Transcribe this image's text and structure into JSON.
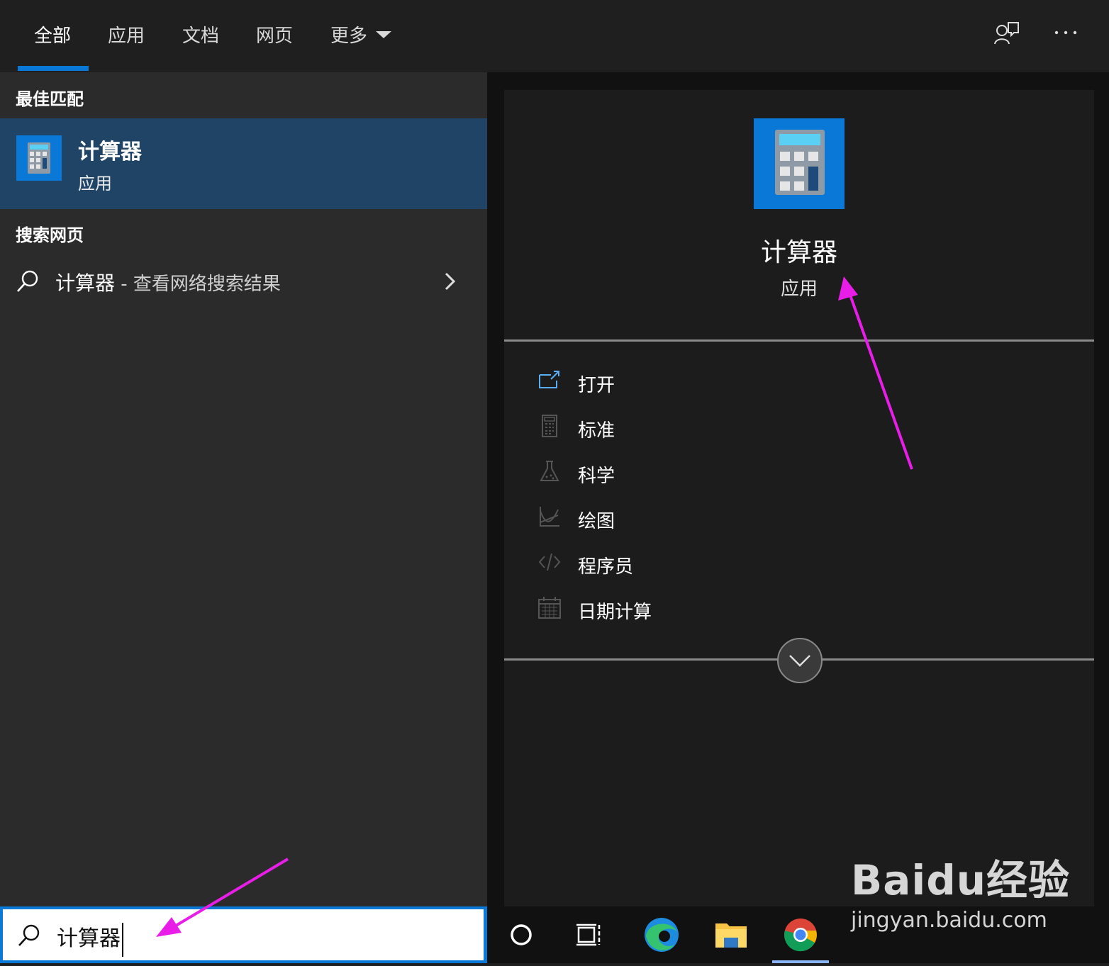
{
  "tabs": [
    "全部",
    "应用",
    "文档",
    "网页",
    "更多"
  ],
  "left": {
    "best_match_heading": "最佳匹配",
    "best_match": {
      "title": "计算器",
      "subtitle": "应用"
    },
    "web_heading": "搜索网页",
    "web_result": {
      "query": "计算器",
      "suffix": " - 查看网络搜索结果"
    }
  },
  "detail": {
    "title": "计算器",
    "subtitle": "应用",
    "actions": [
      {
        "label": "打开",
        "icon": "open-window-icon"
      },
      {
        "label": "标准",
        "icon": "calculator-icon"
      },
      {
        "label": "科学",
        "icon": "flask-icon"
      },
      {
        "label": "绘图",
        "icon": "graph-icon"
      },
      {
        "label": "程序员",
        "icon": "code-icon"
      },
      {
        "label": "日期计算",
        "icon": "calendar-icon"
      }
    ]
  },
  "search": {
    "value": "计算器"
  },
  "taskbar": [
    "cortana-icon",
    "task-view-icon",
    "edge-icon",
    "file-explorer-icon",
    "chrome-icon"
  ],
  "watermark": {
    "logo": "Baidu经验",
    "url": "jingyan.baidu.com"
  },
  "colors": {
    "accent": "#0a78d7",
    "selected": "#1f4465",
    "annotation_arrow": "#e81ee8"
  }
}
